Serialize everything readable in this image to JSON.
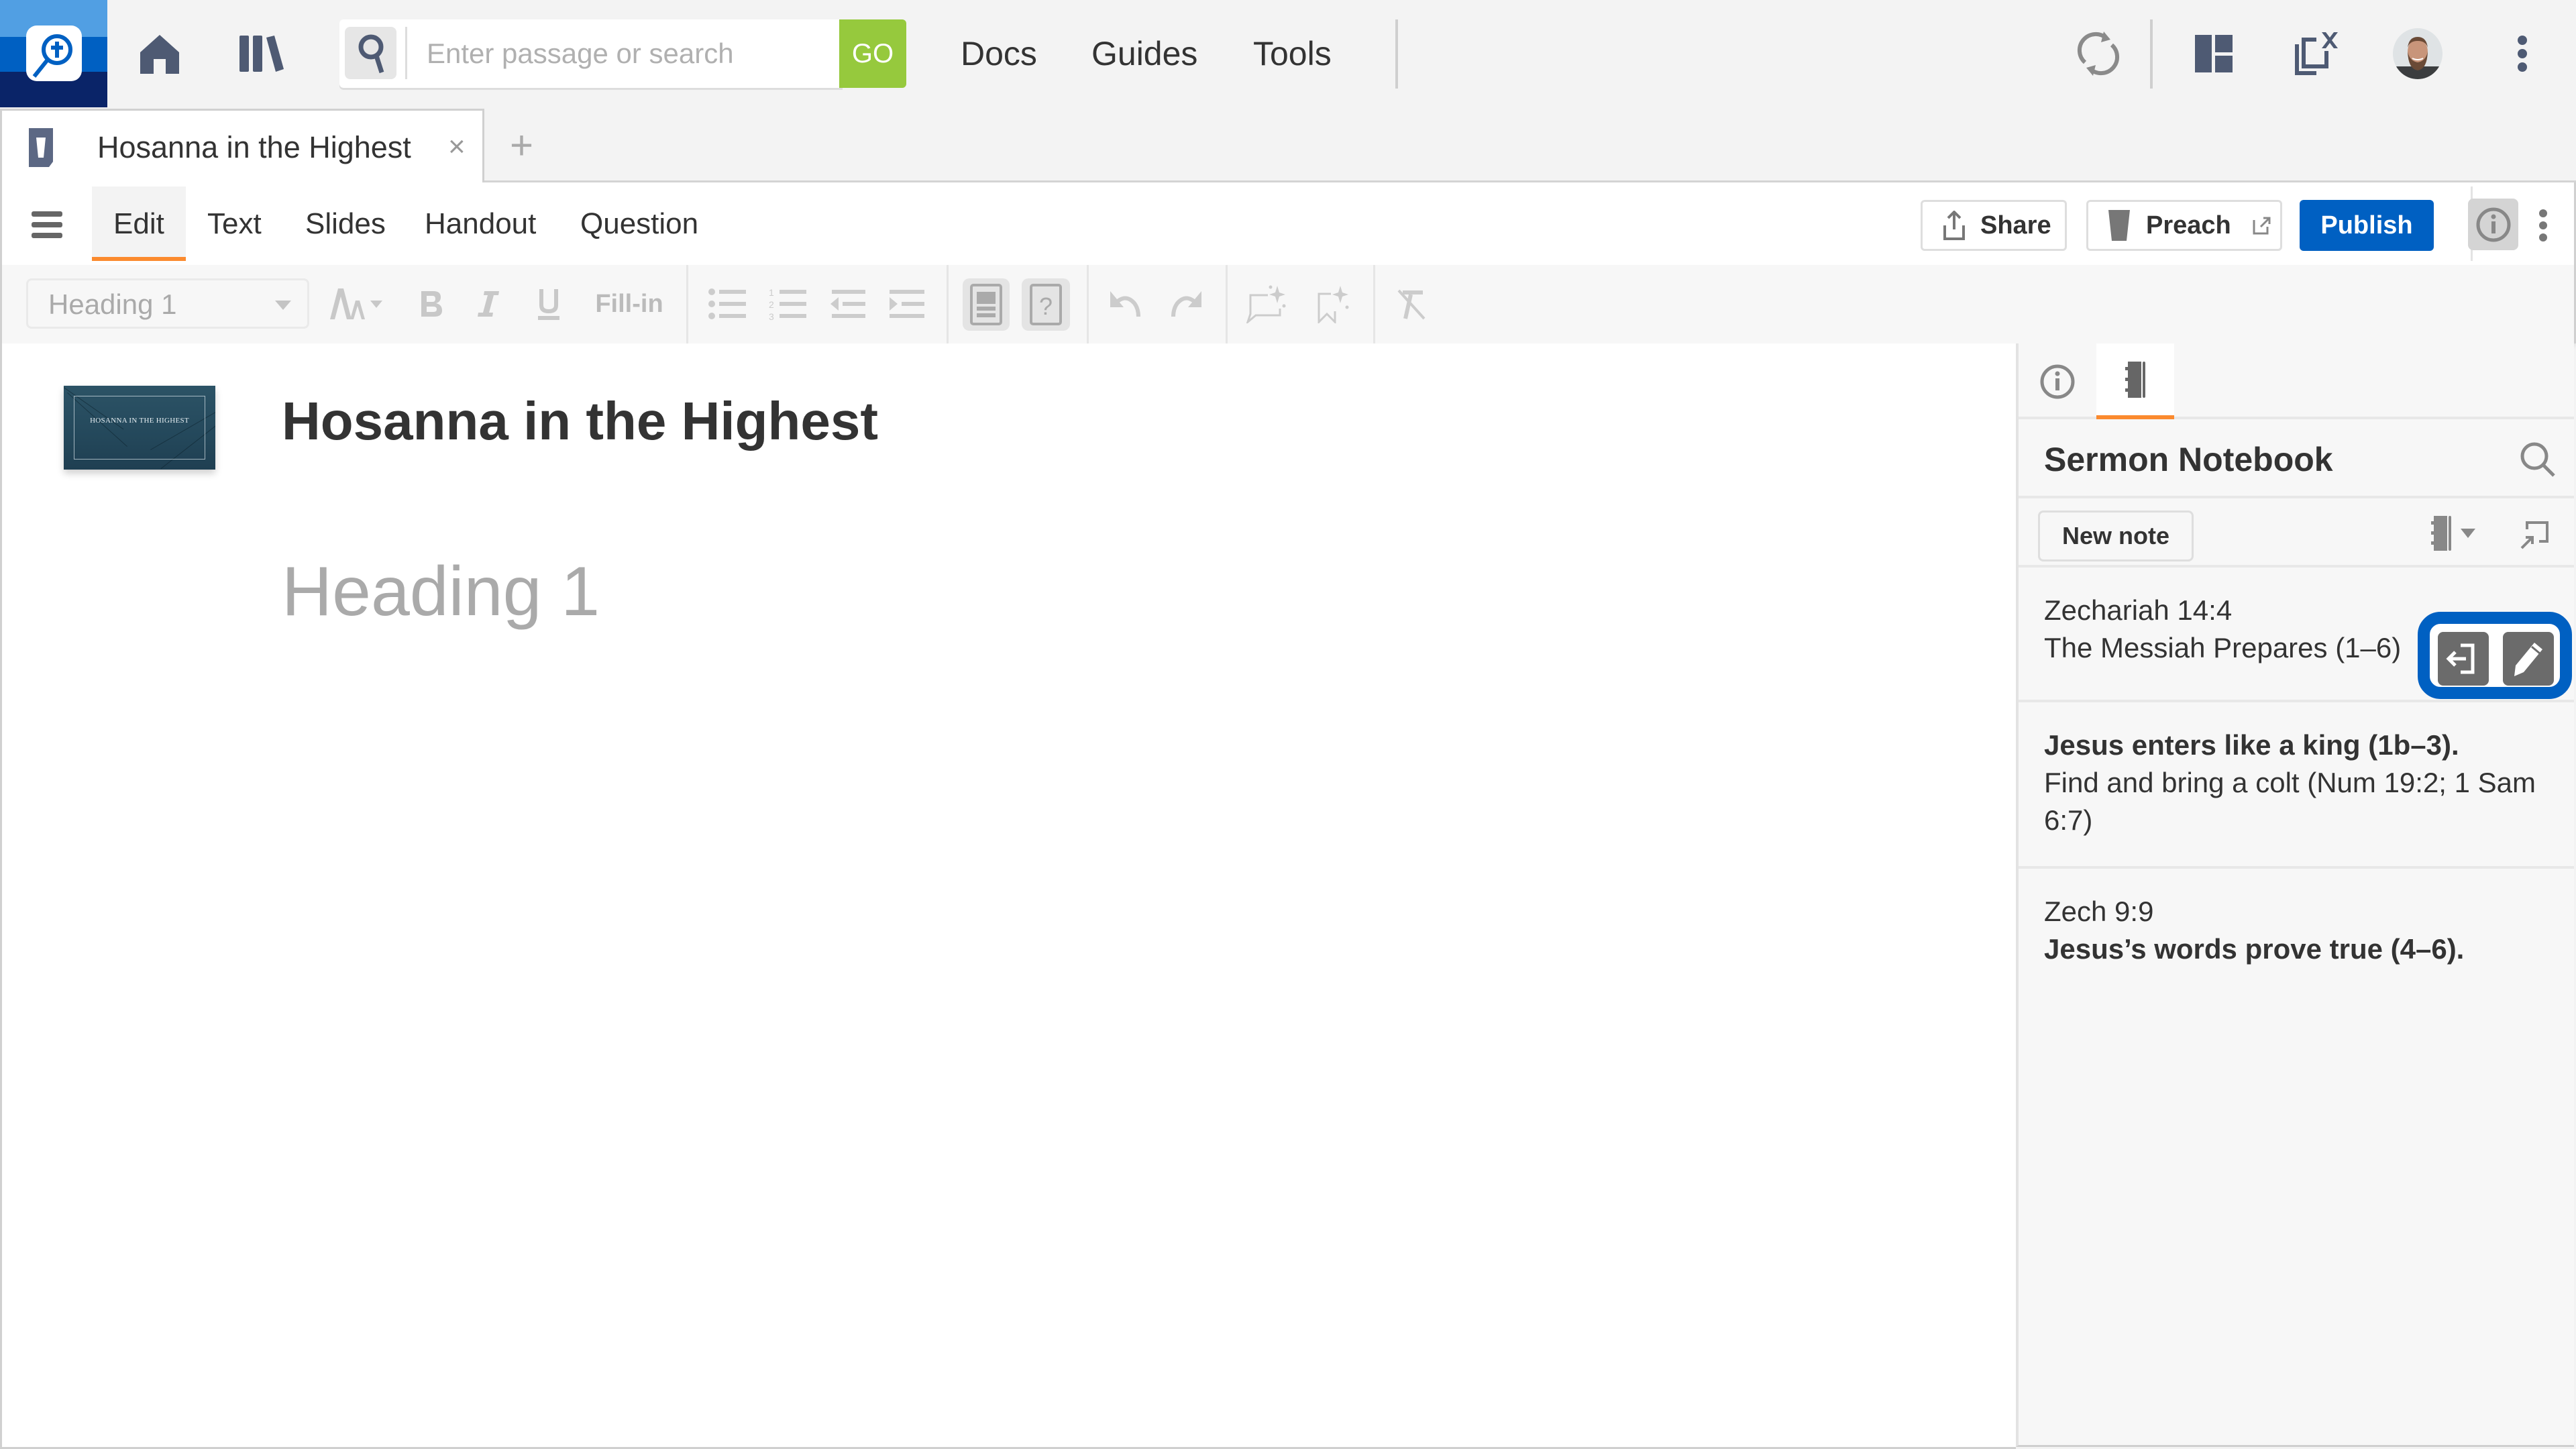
{
  "topbar": {
    "search_placeholder": "Enter passage or search",
    "go_label": "GO",
    "nav": [
      "Docs",
      "Guides",
      "Tools"
    ]
  },
  "tabs": {
    "active_title": "Hosanna in the Highest",
    "close_glyph": "×",
    "new_tab_glyph": "+"
  },
  "ribbon": {
    "tabs": [
      "Edit",
      "Text",
      "Slides",
      "Handout",
      "Question"
    ],
    "active_tab": "Edit",
    "share_label": "Share",
    "preach_label": "Preach",
    "publish_label": "Publish"
  },
  "format_toolbar": {
    "style_value": "Heading 1",
    "fill_in_label": "Fill-in"
  },
  "document": {
    "thumbnail_text": "HOSANNA IN THE HIGHEST",
    "title": "Hosanna in the Highest",
    "heading_placeholder": "Heading 1"
  },
  "sidebar": {
    "title": "Sermon Notebook",
    "new_note_label": "New note",
    "notes": [
      {
        "lines": [
          {
            "text": "Zechariah 14:4",
            "bold": false
          },
          {
            "text": "The Messiah Prepares (1–6)",
            "bold": false
          }
        ]
      },
      {
        "lines": [
          {
            "text": "Jesus enters like a king (1b–3).",
            "bold": true
          },
          {
            "text": "Find and bring a colt (Num 19:2; 1 Sam",
            "bold": false
          },
          {
            "text": "6:7)",
            "bold": false
          }
        ]
      },
      {
        "lines": [
          {
            "text": "Zech 9:9",
            "bold": false
          },
          {
            "text": "Jesus’s words prove true (4–6).",
            "bold": true
          }
        ]
      }
    ]
  },
  "colors": {
    "accent_orange": "#fb8a2e",
    "publish_blue": "#0060c2",
    "go_green": "#96c93d",
    "icon_slate": "#4e5a73"
  }
}
